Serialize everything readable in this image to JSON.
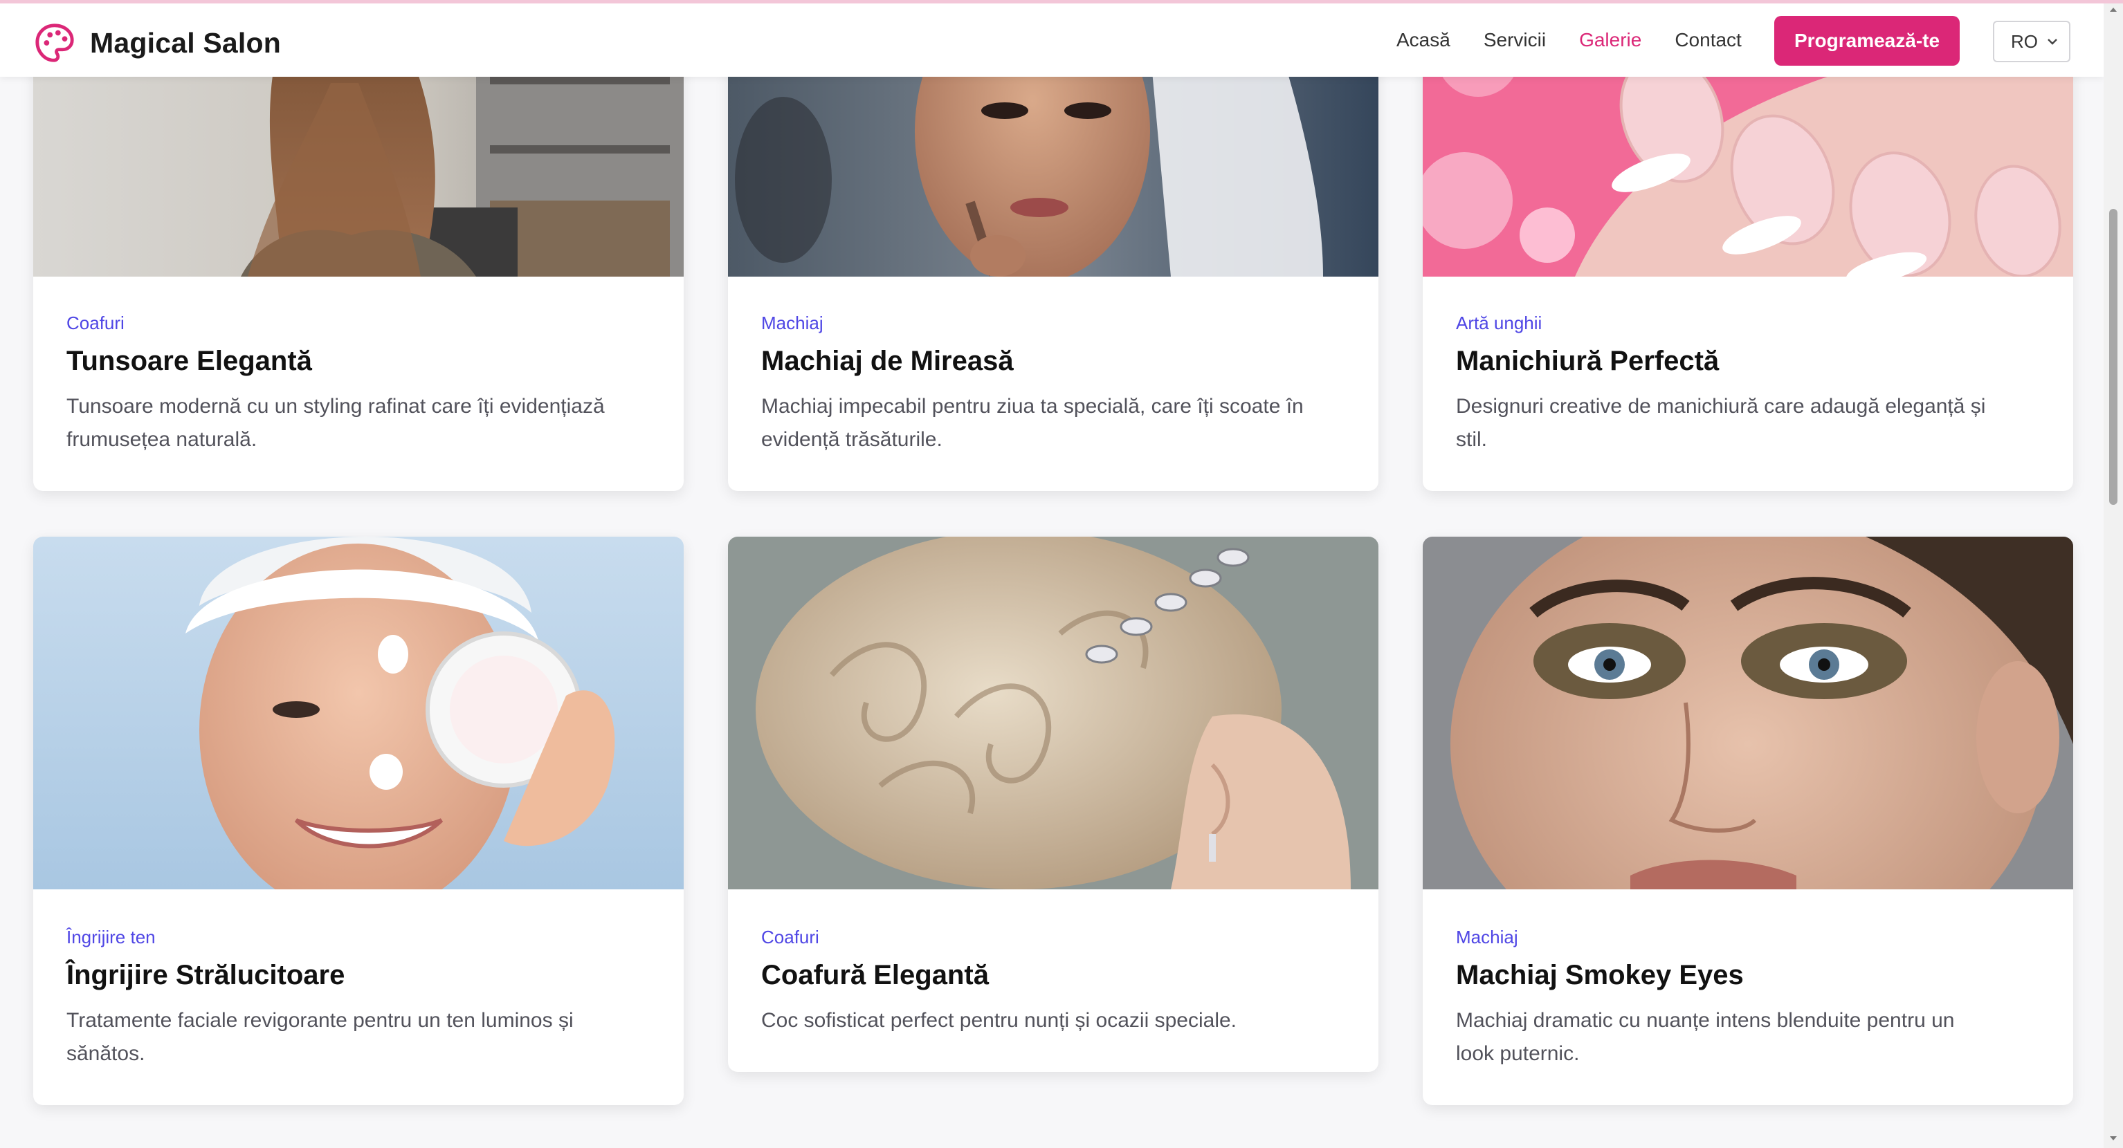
{
  "brand": {
    "name": "Magical Salon",
    "accent": "#db2777",
    "category_color": "#4f46e5"
  },
  "nav": {
    "items": [
      {
        "label": "Acasă",
        "active": false
      },
      {
        "label": "Servicii",
        "active": false
      },
      {
        "label": "Galerie",
        "active": true
      },
      {
        "label": "Contact",
        "active": false
      }
    ],
    "cta_label": "Programează-te",
    "language": "RO"
  },
  "gallery": {
    "cards": [
      {
        "category": "Coafuri",
        "title": "Tunsoare Elegantă",
        "line1": "Tunsoare modernă cu un styling rafinat care îți evidențiază",
        "line2": "frumusețea naturală.",
        "image": "long-wavy-hair-salon-photo"
      },
      {
        "category": "Machiaj",
        "title": "Machiaj de Mireasă",
        "line1": "Machiaj impecabil pentru ziua ta specială, care îți scoate în",
        "line2": "evidență trăsăturile.",
        "image": "bridal-makeup-photo"
      },
      {
        "category": "Artă unghii",
        "title": "Manichiură Perfectă",
        "line1": "Designuri creative de manichiură care adaugă eleganță și",
        "line2": "stil.",
        "image": "french-manicure-photo"
      },
      {
        "category": "Îngrijire ten",
        "title": "Îngrijire Strălucitoare",
        "line1": "Tratamente faciale revigorante pentru un ten luminos și",
        "line2": "sănătos.",
        "image": "skincare-cream-photo"
      },
      {
        "category": "Coafuri",
        "title": "Coafură Elegantă",
        "line1": "Coc sofisticat perfect pentru nunți și ocazii speciale.",
        "line2": "",
        "image": "bridal-updo-photo"
      },
      {
        "category": "Machiaj",
        "title": "Machiaj Smokey Eyes",
        "line1": "Machiaj dramatic cu nuanțe intens blenduite pentru un",
        "line2": "look puternic.",
        "image": "smokey-eyes-photo"
      }
    ]
  }
}
